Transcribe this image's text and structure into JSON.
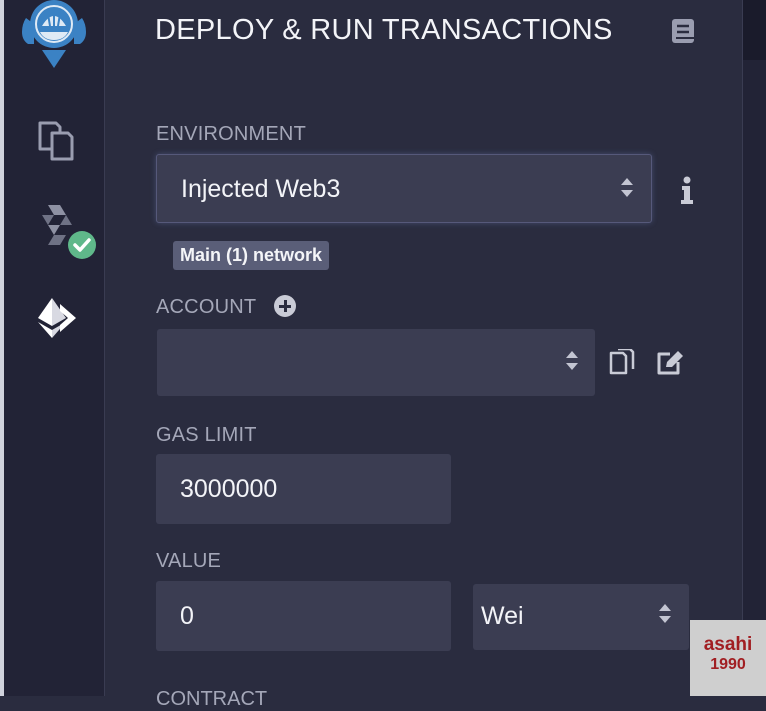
{
  "panel": {
    "title": "DEPLOY & RUN TRANSACTIONS"
  },
  "sidebar": {
    "icons": [
      "remix-logo-icon",
      "file-explorer-icon",
      "solidity-compiler-icon",
      "deploy-run-icon"
    ]
  },
  "environment": {
    "label": "ENVIRONMENT",
    "selected": "Injected Web3",
    "network_badge": "Main (1) network"
  },
  "account": {
    "label": "ACCOUNT",
    "selected": ""
  },
  "gas_limit": {
    "label": "GAS LIMIT",
    "value": "3000000"
  },
  "value": {
    "label": "VALUE",
    "amount": "0",
    "unit": "Wei"
  },
  "contract": {
    "label": "CONTRACT"
  },
  "watermark": {
    "line1": "asahi",
    "line2": "1990"
  },
  "colors": {
    "background": "#2a2c3f",
    "icon_panel": "#222336",
    "input": "#3b3d52",
    "accent_green": "#5fb88a",
    "logo_blue": "#3b82c4"
  }
}
